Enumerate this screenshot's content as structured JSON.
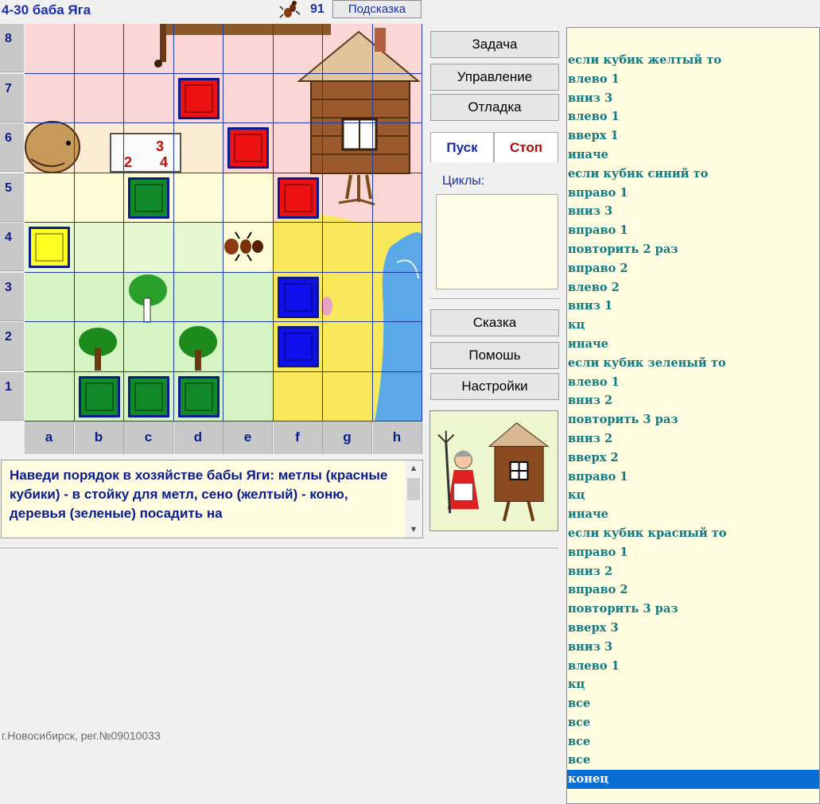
{
  "header": {
    "title": "4-30 баба Яга",
    "score": "91",
    "hint_label": "Подсказка"
  },
  "board": {
    "rows": [
      "8",
      "7",
      "6",
      "5",
      "4",
      "3",
      "2",
      "1"
    ],
    "cols": [
      "a",
      "b",
      "c",
      "d",
      "e",
      "f",
      "g",
      "h"
    ],
    "cubes": [
      {
        "col": "d",
        "row": "7",
        "color": "red"
      },
      {
        "col": "e",
        "row": "6",
        "color": "red"
      },
      {
        "col": "f",
        "row": "5",
        "color": "red"
      },
      {
        "col": "c",
        "row": "5",
        "color": "green"
      },
      {
        "col": "a",
        "row": "4",
        "color": "yellow"
      },
      {
        "col": "f",
        "row": "3",
        "color": "blue"
      },
      {
        "col": "f",
        "row": "2",
        "color": "blue"
      },
      {
        "col": "b",
        "row": "1",
        "color": "green"
      },
      {
        "col": "c",
        "row": "1",
        "color": "green"
      },
      {
        "col": "d",
        "row": "1",
        "color": "green"
      }
    ],
    "colors": {
      "red": "#ee1111",
      "green": "#118a2a",
      "yellow": "#ffff22",
      "blue": "#1010ee"
    },
    "calendar": {
      "top": "3",
      "bottom_left": "2",
      "bottom_right": "4"
    }
  },
  "buttons": {
    "task": "Задача",
    "control": "Управление",
    "debug": "Отладка",
    "run": "Пуск",
    "stop": "Стоп",
    "loops_label": "Циклы:",
    "tale": "Сказка",
    "help": "Помошь",
    "settings": "Настройки"
  },
  "task_text": "Наведи порядок в хозяйстве бабы Яги: метлы (красные кубики) - в стойку для метл, сено (желтый) - коню, деревья (зеленые) посадить на",
  "footer": "г.Новосибирск, рег.№09010033",
  "program": [
    "если кубик желтый то",
    "влево 1",
    "вниз 3",
    "влево 1",
    "вверх 1",
    "иначе",
    "если кубик синий то",
    "вправо 1",
    "вниз 3",
    "вправо 1",
    "повторить 2 раз",
    "вправо 2",
    "влево 2",
    "вниз 1",
    "кц",
    "иначе",
    "если кубик зеленый то",
    "влево 1",
    "вниз 2",
    "повторить 3 раз",
    "вниз 2",
    "вверх 2",
    "вправо 1",
    "кц",
    "иначе",
    "если кубик красный то",
    "вправо 1",
    "вниз 2",
    "вправо 2",
    "повторить 3 раз",
    "вверх 3",
    "вниз 3",
    "влево 1",
    "кц",
    "все",
    "все",
    "все",
    "все",
    "конец"
  ],
  "selected_line": 38
}
